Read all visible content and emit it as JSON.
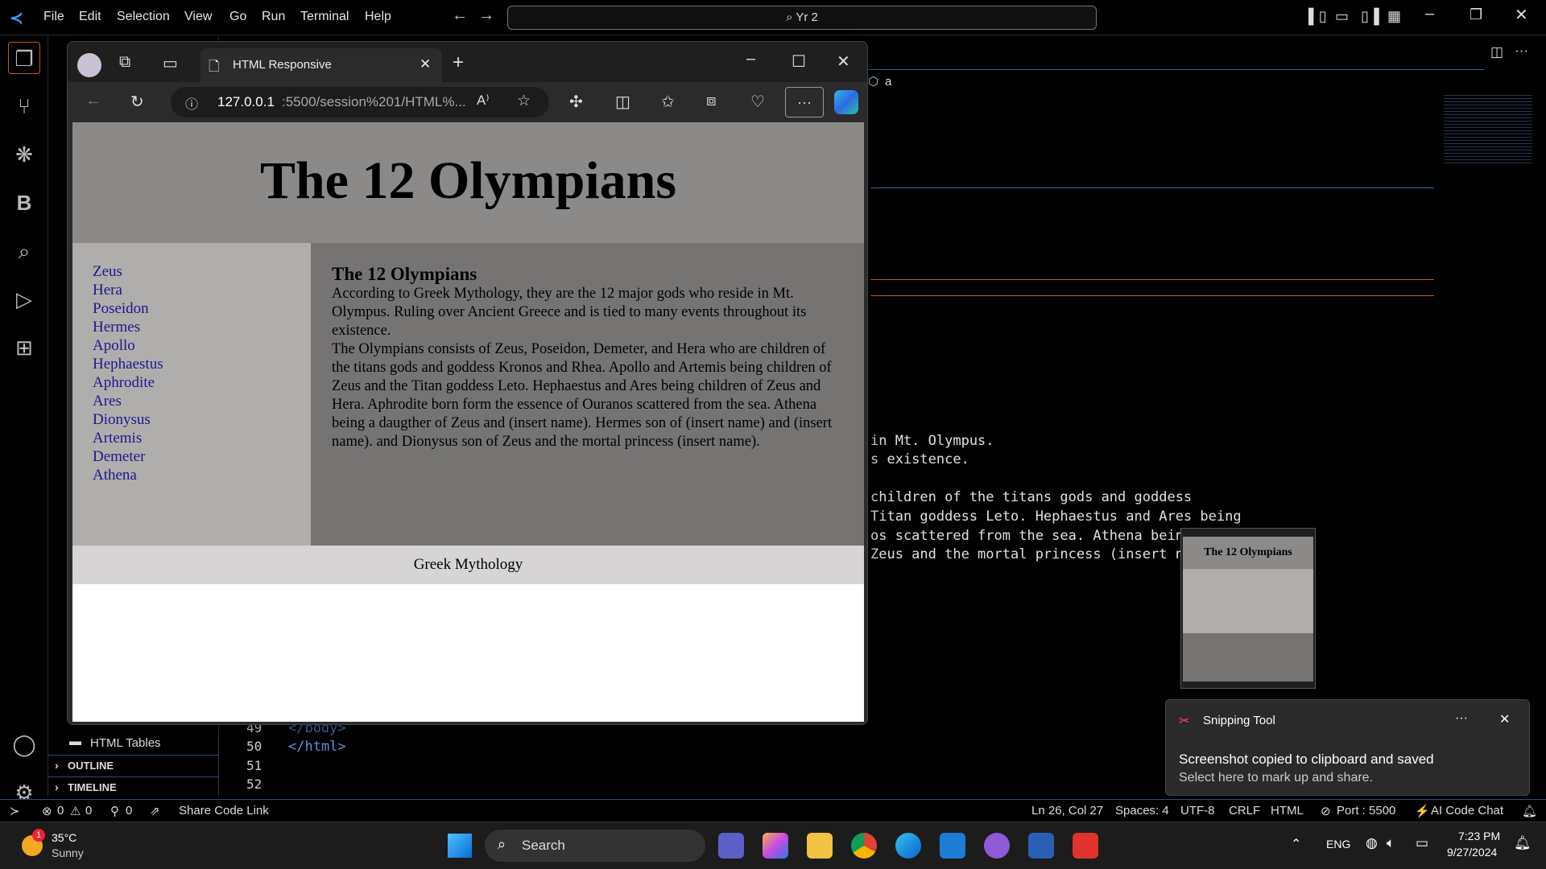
{
  "vscode": {
    "menu": [
      "File",
      "Edit",
      "Selection",
      "View",
      "Go",
      "Run",
      "Terminal",
      "Help"
    ],
    "command_center": "Yr 2",
    "breadcrumb_tail": "a",
    "explorer_items": [
      "HTML Tables"
    ],
    "sections": {
      "outline": "OUTLINE",
      "timeline": "TIMELINE"
    },
    "line_numbers": [
      "49",
      "50",
      "51",
      "52"
    ],
    "code_lines": [
      "</body>",
      "</html>"
    ],
    "bg_code": [
      "in Mt. Olympus.",
      "s existence.",
      "children of the titans gods and goddess",
      "Titan goddess Leto. Hephaestus and Ares being",
      "os scattered from the sea. Athena bein",
      "Zeus and the mortal princess (insert n"
    ],
    "status": {
      "errors": "0",
      "warnings": "0",
      "ports": "0",
      "share": "Share Code Link",
      "position": "Ln 26, Col 27",
      "spaces": "Spaces: 4",
      "encoding": "UTF-8",
      "eol": "CRLF",
      "language": "HTML",
      "port": "Port : 5500",
      "ai": "AI Code Chat"
    }
  },
  "browser": {
    "tab_title": "HTML Responsive",
    "url_host": "127.0.0.1",
    "url_rest": ":5500/session%201/HTML%..."
  },
  "page": {
    "title": "The 12 Olympians",
    "nav": [
      "Zeus",
      "Hera",
      "Poseidon",
      "Hermes",
      "Apollo",
      "Hephaestus",
      "Aphrodite",
      "Ares",
      "Dionysus",
      "Artemis",
      "Demeter",
      "Athena"
    ],
    "main_heading": "The 12 Olympians",
    "para1": "According to Greek Mythology, they are the 12 major gods who reside in Mt. Olympus. Ruling over Ancient Greece and is tied to many events throughout its existence.",
    "para2": "The Olympians consists of Zeus, Poseidon, Demeter, and Hera who are children of the titans gods and goddess Kronos and Rhea. Apollo and Artemis being children of Zeus and the Titan goddess Leto. Hephaestus and Ares being children of Zeus and Hera. Aphrodite born form the essence of Ouranos scattered from the sea. Athena being a daugther of Zeus and (insert name). Hermes son of (insert name) and (insert name). and Dionysus son of Zeus and the mortal princess (insert name).",
    "footer": "Greek Mythology"
  },
  "toast": {
    "app": "Snipping Tool",
    "title": "Screenshot copied to clipboard and saved",
    "body": "Select here to mark up and share.",
    "thumb_title": "The 12 Olympians"
  },
  "taskbar": {
    "weather_temp": "35°C",
    "weather_desc": "Sunny",
    "weather_badge": "1",
    "search": "Search",
    "lang": "ENG",
    "time": "7:23 PM",
    "date": "9/27/2024"
  },
  "colors": {
    "accent": "#0078d4",
    "page_header": "#8c8989",
    "page_nav": "#b0adad",
    "page_main": "#767373",
    "page_footer": "#d6d4d4"
  }
}
